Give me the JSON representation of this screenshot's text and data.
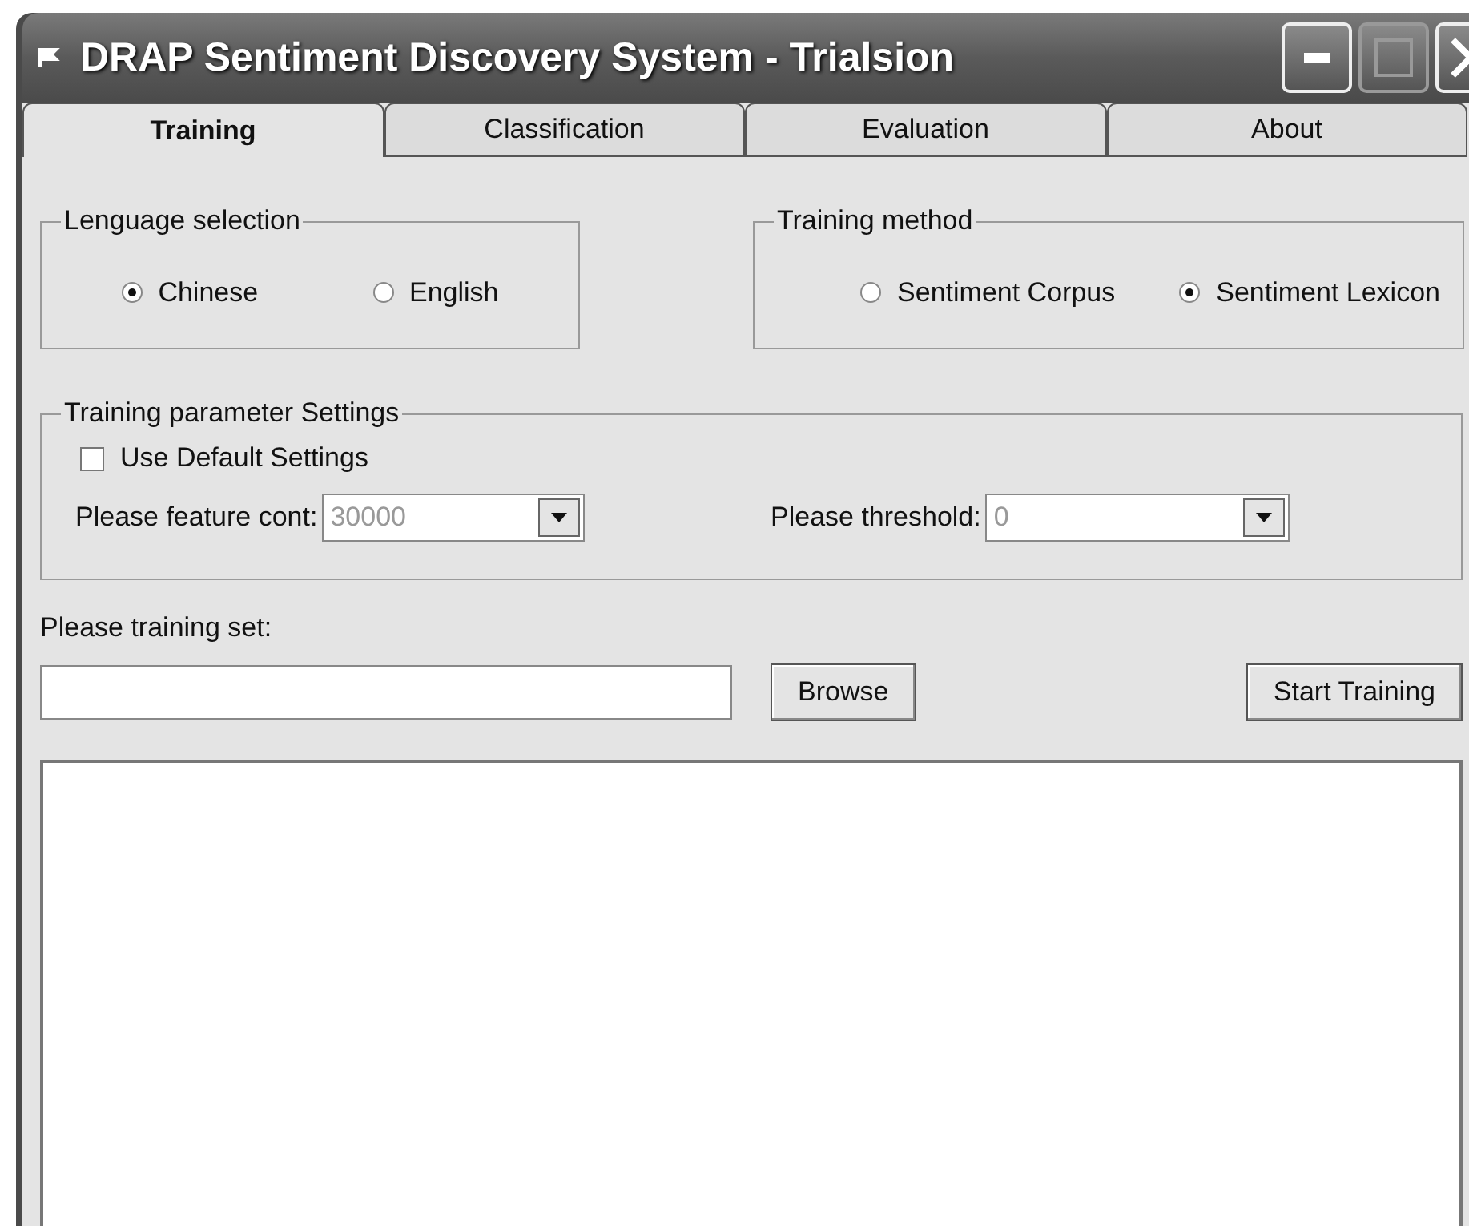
{
  "window": {
    "title": "DRAP Sentiment Discovery System - Trialsion"
  },
  "tabs": [
    {
      "label": "Training",
      "selected": true
    },
    {
      "label": "Classification",
      "selected": false
    },
    {
      "label": "Evaluation",
      "selected": false
    },
    {
      "label": "About",
      "selected": false
    }
  ],
  "language_group": {
    "title": "Lenguage selection",
    "options": [
      {
        "label": "Chinese",
        "selected": true
      },
      {
        "label": "English",
        "selected": false
      }
    ]
  },
  "method_group": {
    "title": "Training method",
    "options": [
      {
        "label": "Sentiment Corpus",
        "selected": false
      },
      {
        "label": "Sentiment Lexicon",
        "selected": true
      }
    ]
  },
  "parameters": {
    "title": "Training parameter Settings",
    "checkbox": {
      "label": "Use Default Settings",
      "checked": false
    },
    "dropdowns": [
      {
        "label": "Please feature cont:",
        "value": "30000",
        "disabled": true
      },
      {
        "label": "Please threshold:",
        "value": "0",
        "disabled": true
      }
    ]
  },
  "training_set": {
    "label": "Please training set:"
  },
  "buttons": [
    "Browse",
    "Start Training"
  ]
}
